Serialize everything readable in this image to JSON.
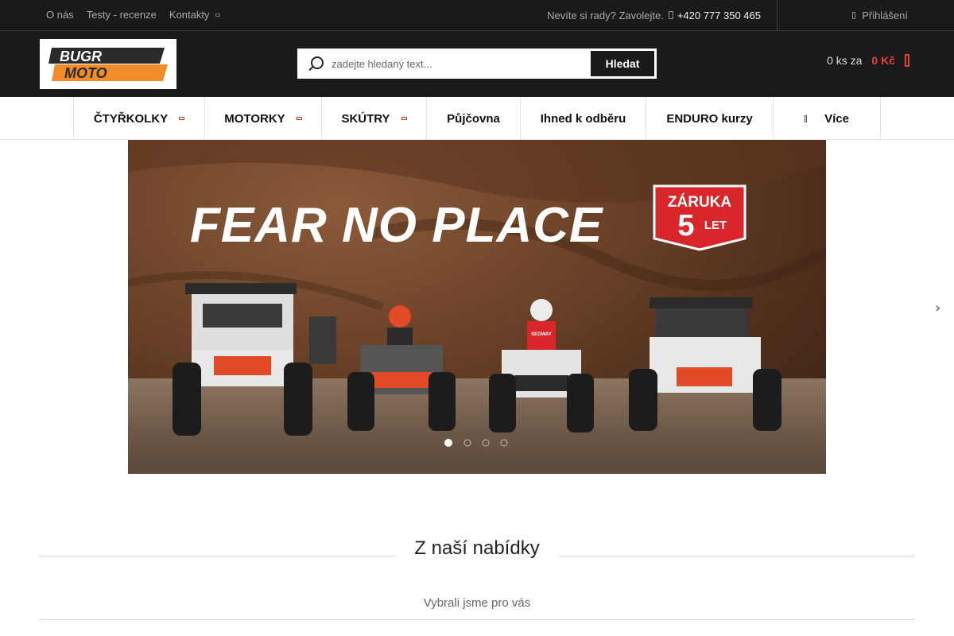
{
  "topbar": {
    "links": [
      "O nás",
      "Testy - recenze",
      "Kontakty"
    ],
    "help_text": "Nevíte si rady? Zavolejte.",
    "phone": "+420 777 350 465",
    "login": "Přihlášení"
  },
  "header": {
    "logo_line1": "BUGR",
    "logo_line2": "MOTO",
    "search_placeholder": "zadejte hledaný text...",
    "search_button": "Hledat",
    "cart_count": "0 ks za",
    "cart_price": "0 Kč"
  },
  "nav": {
    "items": [
      {
        "label": "ČTYŘKOLKY"
      },
      {
        "label": "MOTORKY"
      },
      {
        "label": "SKÚTRY"
      },
      {
        "label": "Půjčovna"
      },
      {
        "label": "Ihned k odběru"
      },
      {
        "label": "ENDURO kurzy"
      },
      {
        "label": "Více"
      }
    ]
  },
  "banner": {
    "headline": "FEAR NO PLACE",
    "warranty_line1": "ZÁRUKA",
    "warranty_number": "5",
    "warranty_line2": "LET",
    "brand_on_jersey": "SEGWAY",
    "active_slide": 1,
    "slide_count": 4
  },
  "section": {
    "title": "Z naší nabídky",
    "subtitle": "Vybrali jsme pro vás"
  },
  "colors": {
    "accent": "#e8413a",
    "dark": "#1a1a1a"
  }
}
